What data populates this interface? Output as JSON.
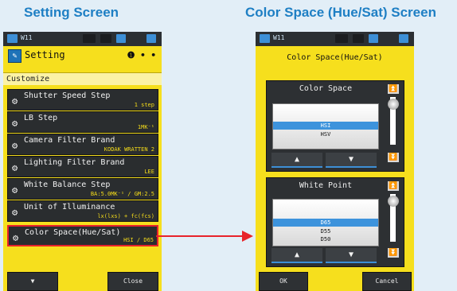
{
  "captions": {
    "left": "Setting Screen",
    "right": "Color Space (Hue/Sat) Screen"
  },
  "left_screen": {
    "status_label": "W11",
    "title": "Setting",
    "page_indicator": "❶ • •",
    "section": "Customize",
    "items": [
      {
        "label": "Shutter Speed Step",
        "value": "1 step"
      },
      {
        "label": "LB Step",
        "value": "1MK⁻¹"
      },
      {
        "label": "Camera Filter Brand",
        "value": "KODAK WRATTEN 2"
      },
      {
        "label": "Lighting Filter Brand",
        "value": "LEE"
      },
      {
        "label": "White Balance Step",
        "value": "BA:5.0MK⁻¹ / GM:2.5"
      },
      {
        "label": "Unit of Illuminance",
        "value": "lx(lxs) + fc(fcs)"
      },
      {
        "label": "Color Space(Hue/Sat)",
        "value": "HSI / D65"
      }
    ],
    "buttons": {
      "down": "▼",
      "close": "Close"
    }
  },
  "right_screen": {
    "status_label": "W11",
    "title": "Color Space(Hue/Sat)",
    "color_space": {
      "title": "Color Space",
      "options": [
        "HSI",
        "HSV"
      ],
      "selected": "HSI"
    },
    "white_point": {
      "title": "White Point",
      "options": [
        "D65",
        "D55",
        "D50"
      ],
      "selected": "D65"
    },
    "arrows": {
      "up": "▲",
      "down": "▼",
      "bottom": "⏬",
      "top": "⏫"
    },
    "buttons": {
      "ok": "OK",
      "cancel": "Cancel"
    }
  },
  "colors": {
    "accent": "#1e7fc4",
    "screen_bg": "#f6df1d",
    "highlight": "#e8232a",
    "selected_item": "#3d93dc"
  }
}
